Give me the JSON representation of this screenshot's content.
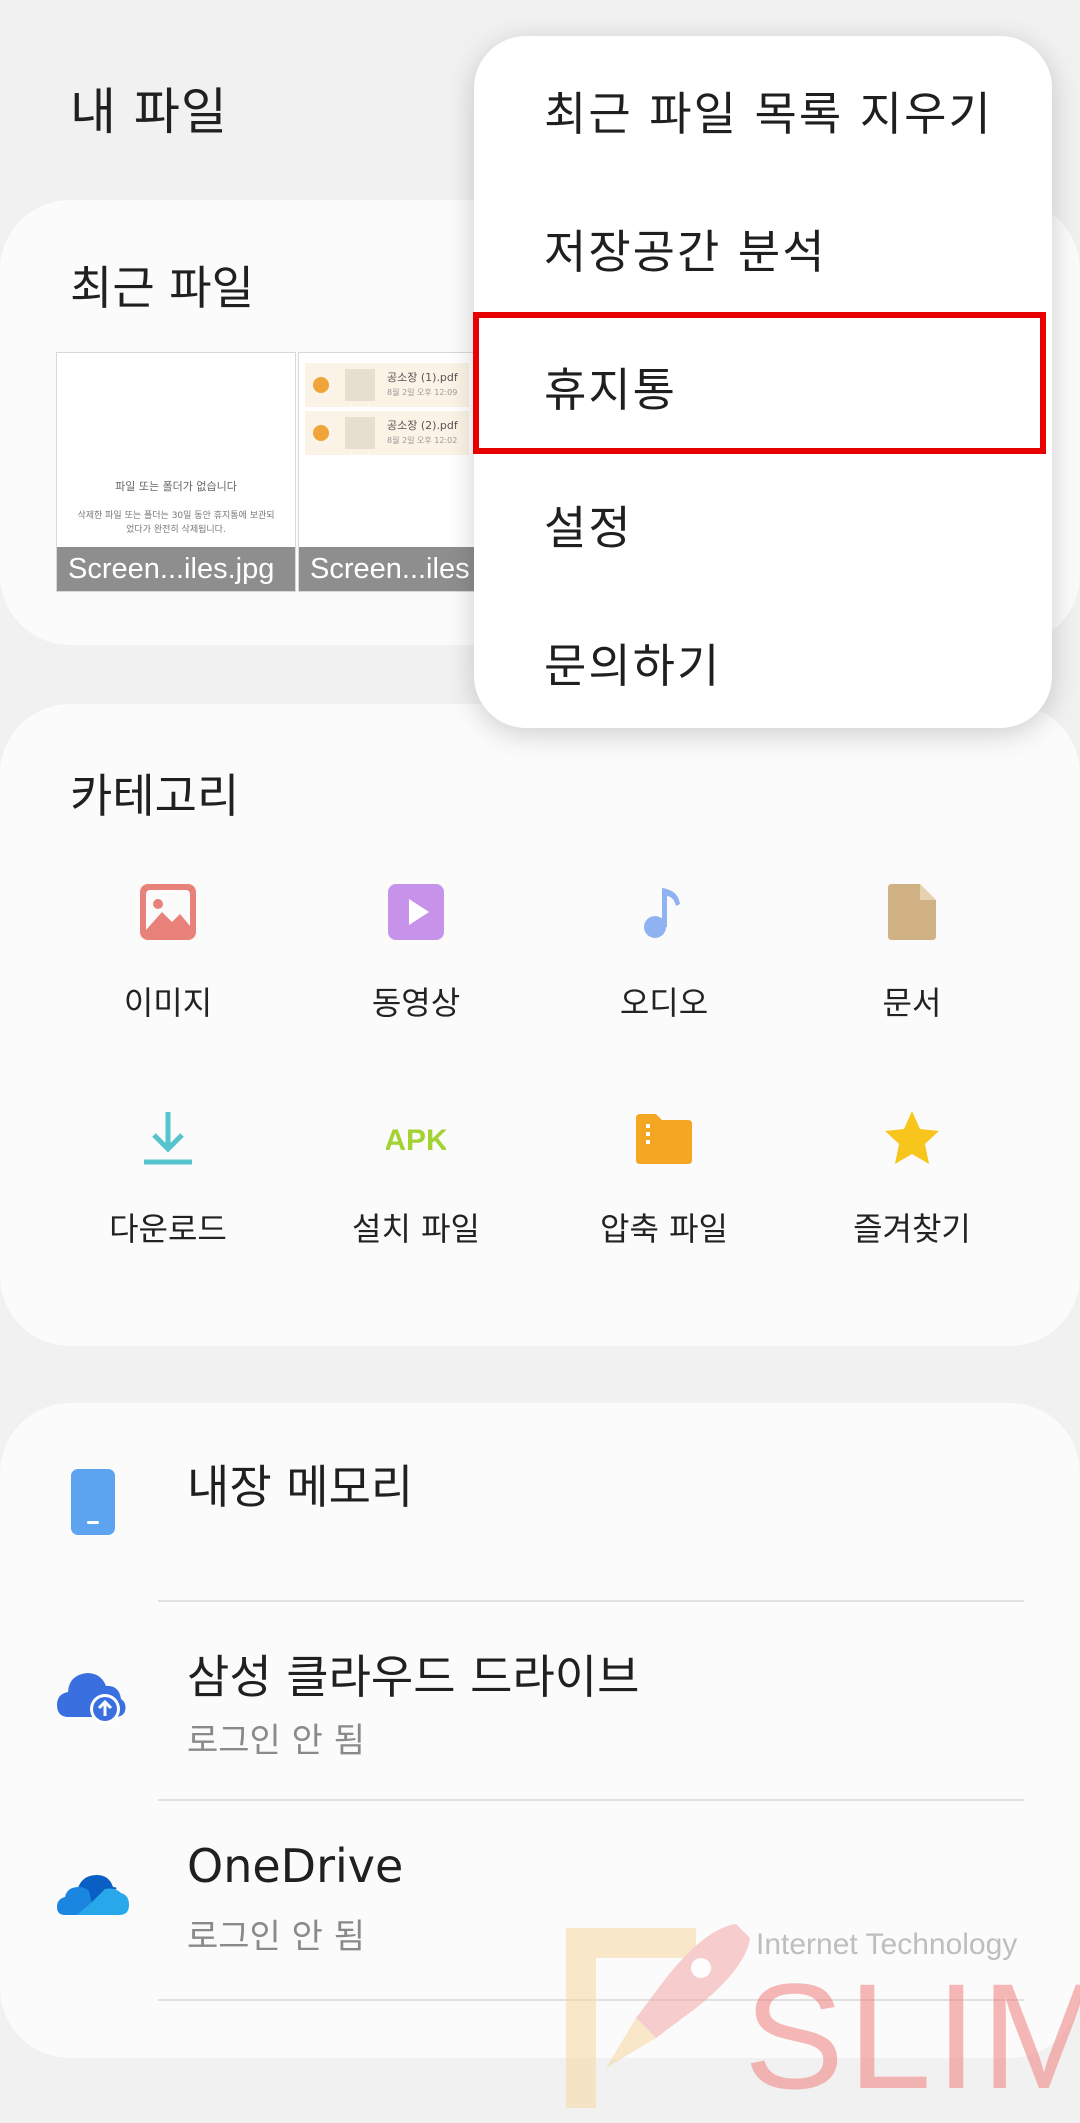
{
  "header": {
    "title": "내 파일"
  },
  "recent": {
    "title": "최근 파일",
    "files": [
      {
        "caption": "Screen...iles.jpg",
        "empty_title": "파일 또는 폴더가 없습니다",
        "empty_desc": "삭제한 파일 또는 폴더는 30일 동안 휴지통에 보관되었다가 완전히 삭제됩니다."
      },
      {
        "caption": "Screen...iles",
        "items": [
          {
            "name": "공소장 (1).pdf",
            "date": "8월 2일 오후 12:09"
          },
          {
            "name": "공소장 (2).pdf",
            "date": "8월 2일 오후 12:02"
          }
        ]
      }
    ]
  },
  "category": {
    "title": "카테고리",
    "items": [
      {
        "label": "이미지",
        "icon": "image-icon",
        "color": "#e8817a"
      },
      {
        "label": "동영상",
        "icon": "video-icon",
        "color": "#c792ea"
      },
      {
        "label": "오디오",
        "icon": "music-note-icon",
        "color": "#8fb3f2"
      },
      {
        "label": "문서",
        "icon": "document-icon",
        "color": "#cfb183"
      },
      {
        "label": "다운로드",
        "icon": "download-icon",
        "color": "#56c4cc"
      },
      {
        "label": "설치 파일",
        "icon": "apk-icon",
        "color": "#a4d233"
      },
      {
        "label": "압축 파일",
        "icon": "archive-folder-icon",
        "color": "#f5a623"
      },
      {
        "label": "즐겨찾기",
        "icon": "star-icon",
        "color": "#f8c51c"
      }
    ]
  },
  "storage": {
    "items": [
      {
        "title": "내장 메모리",
        "icon": "phone-icon"
      },
      {
        "title": "삼성 클라우드 드라이브",
        "subtitle": "로그인 안 됨",
        "icon": "cloud-upload-icon"
      },
      {
        "title": "OneDrive",
        "subtitle": "로그인 안 됨",
        "icon": "onedrive-icon"
      }
    ]
  },
  "menu": {
    "items": [
      {
        "label": "최근 파일 목록 지우기"
      },
      {
        "label": "저장공간 분석"
      },
      {
        "label": "휴지통"
      },
      {
        "label": "설정"
      },
      {
        "label": "문의하기"
      }
    ],
    "highlighted": "휴지통",
    "highlight_color": "#e60000"
  },
  "watermark": {
    "line1": "Internet Technology",
    "line2": "SLIM"
  }
}
